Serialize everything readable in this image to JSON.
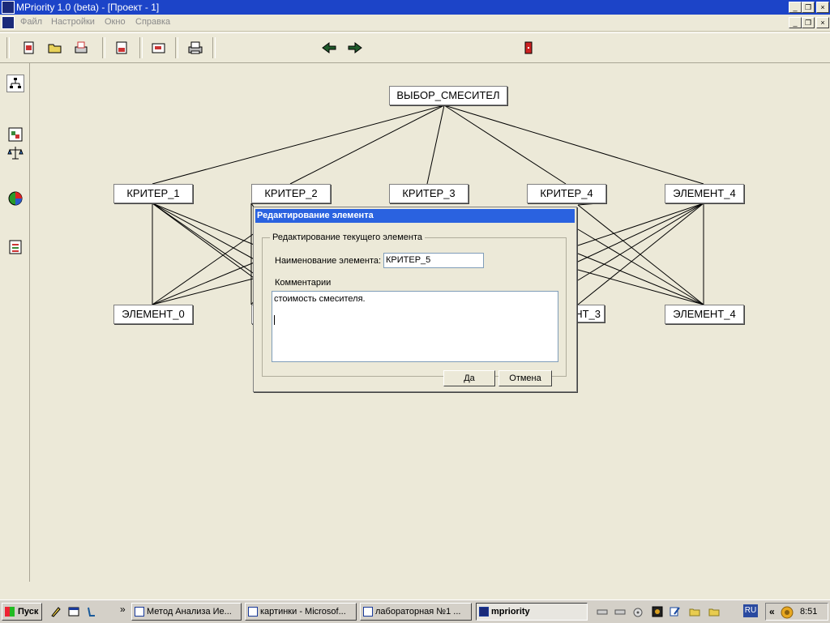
{
  "window": {
    "title": "MPriority 1.0 (beta) - [Проект - 1]"
  },
  "menu": {
    "items": [
      "Файл",
      "Настройки",
      "Окно",
      "Справка"
    ]
  },
  "hierarchy": {
    "goal": "ВЫБОР_СМЕСИТЕЛ",
    "criteria": [
      "КРИТЕР_1",
      "КРИТЕР_2",
      "КРИТЕР_3",
      "КРИТЕР_4",
      "ЭЛЕМЕНТ_4"
    ],
    "alternatives": [
      "ЭЛЕМЕНТ_0",
      "ЭЛЕМЕНТ_3",
      "ЭЛЕМЕНТ_4"
    ]
  },
  "dialog": {
    "title": "Редактирование элемента",
    "group_label": "Редактирование текущего элемента",
    "name_label": "Наименование элемента:",
    "name_value": "КРИТЕР_5",
    "comments_label": "Комментарии",
    "comments_value": "стоимость смесителя.",
    "ok_label": "Да",
    "cancel_label": "Отмена"
  },
  "taskbar": {
    "start_label": "Пуск",
    "chevron": "»",
    "tasks": [
      "Метод Анализа Ие...",
      "картинки - Microsof...",
      "лабораторная №1 ...",
      "mpriority"
    ],
    "language": "RU",
    "tray_chevron": "«",
    "clock": "8:51"
  },
  "colors": {
    "titlebar": "#1c44c8",
    "dialog_title": "#2a62e0",
    "canvas": "#ece9d8"
  }
}
